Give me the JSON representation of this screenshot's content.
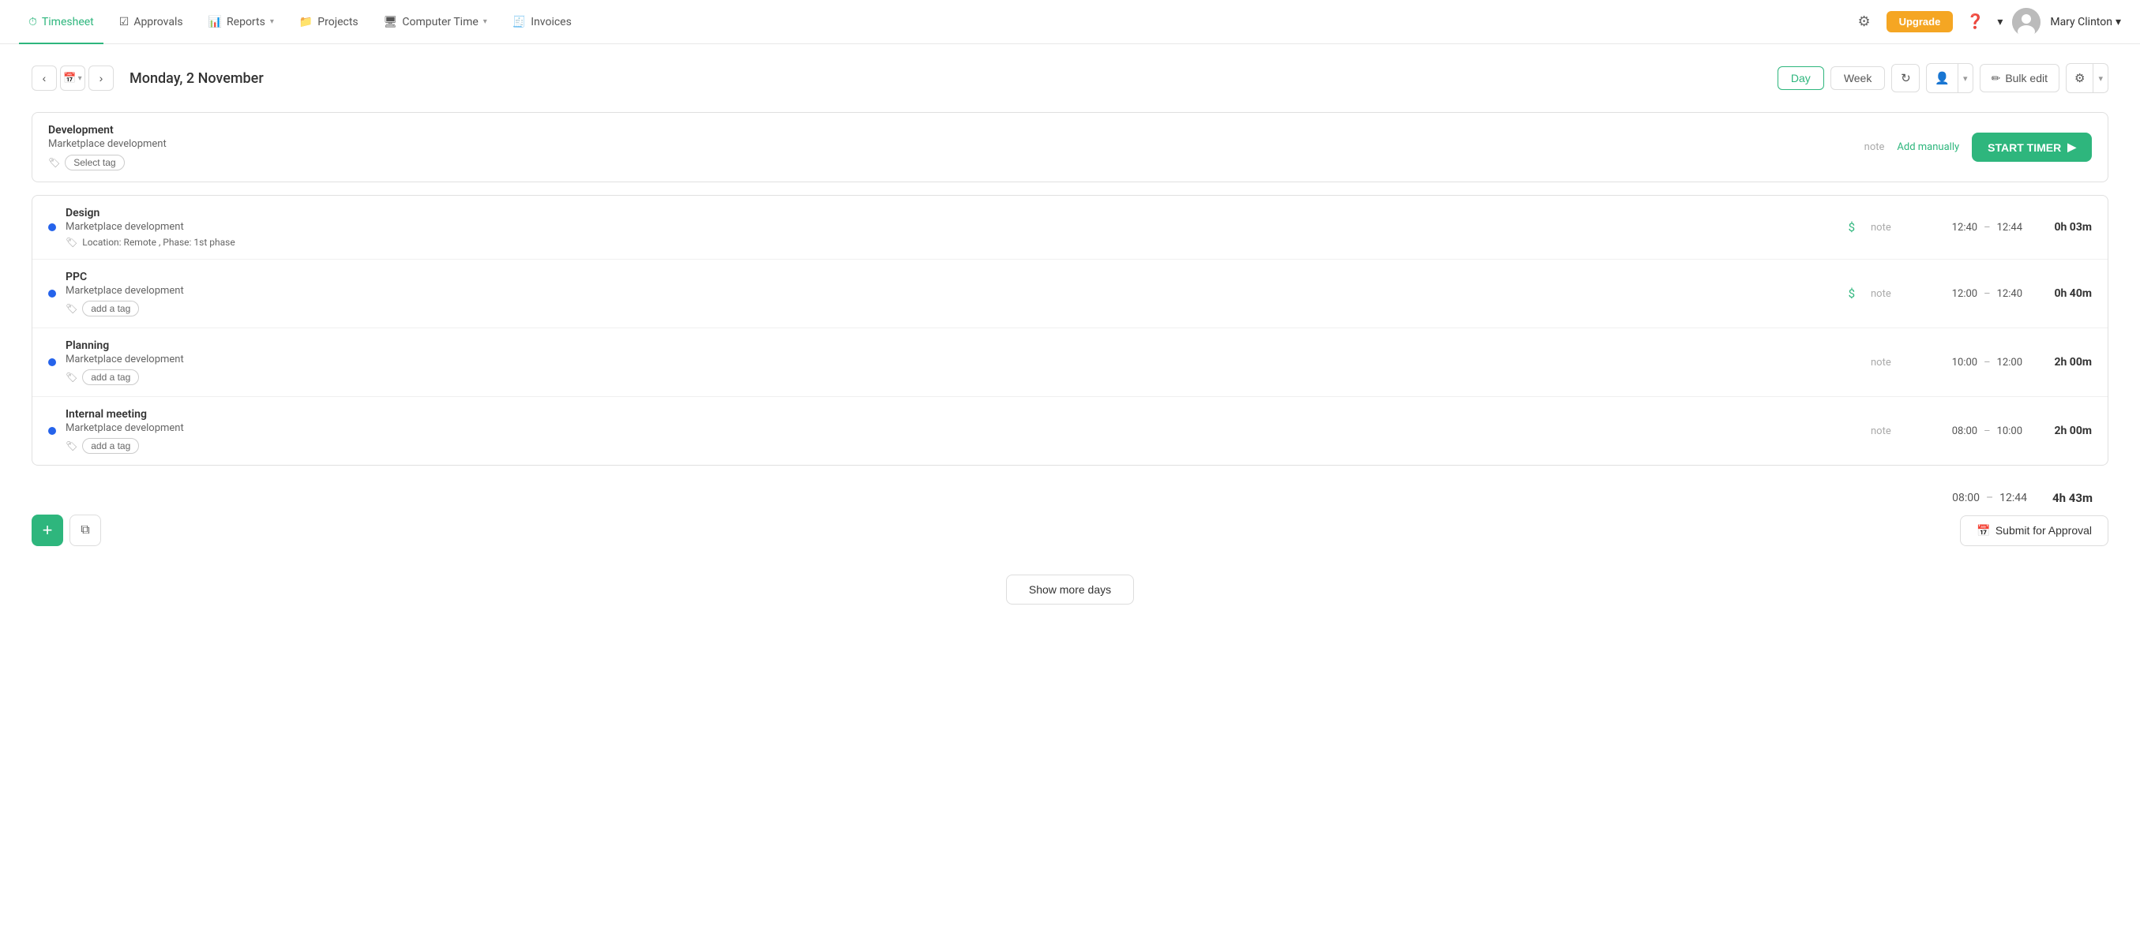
{
  "nav": {
    "items": [
      {
        "label": "Timesheet",
        "id": "timesheet",
        "active": true
      },
      {
        "label": "Approvals",
        "id": "approvals",
        "active": false
      },
      {
        "label": "Reports",
        "id": "reports",
        "active": false,
        "hasChevron": true
      },
      {
        "label": "Projects",
        "id": "projects",
        "active": false
      },
      {
        "label": "Computer Time",
        "id": "computer-time",
        "active": false,
        "hasChevron": true
      },
      {
        "label": "Invoices",
        "id": "invoices",
        "active": false
      }
    ],
    "upgrade_label": "Upgrade",
    "user_name": "Mary Clinton"
  },
  "toolbar": {
    "date": "Monday, 2 November",
    "day_label": "Day",
    "week_label": "Week",
    "bulk_edit_label": "Bulk edit"
  },
  "development_entry": {
    "project": "Development",
    "sub_project": "Marketplace development",
    "select_tag": "Select tag",
    "note": "note",
    "add_manually": "Add manually",
    "start_timer": "START TIMER"
  },
  "time_entries": [
    {
      "title": "Design",
      "project": "Marketplace development",
      "tags": "Location: Remote , Phase: 1st phase",
      "billable": true,
      "note": "note",
      "start": "12:40",
      "end": "12:44",
      "duration": "0h 03m"
    },
    {
      "title": "PPC",
      "project": "Marketplace development",
      "tags": null,
      "add_tag": "add a tag",
      "billable": true,
      "note": "note",
      "start": "12:00",
      "end": "12:40",
      "duration": "0h 40m"
    },
    {
      "title": "Planning",
      "project": "Marketplace development",
      "tags": null,
      "add_tag": "add a tag",
      "billable": false,
      "note": "note",
      "start": "10:00",
      "end": "12:00",
      "duration": "2h 00m"
    },
    {
      "title": "Internal meeting",
      "project": "Marketplace development",
      "tags": null,
      "add_tag": "add a tag",
      "billable": false,
      "note": "note",
      "start": "08:00",
      "end": "10:00",
      "duration": "2h 00m"
    }
  ],
  "summary": {
    "start": "08:00",
    "end": "12:44",
    "duration": "4h 43m",
    "submit_label": "Submit for Approval",
    "show_more": "Show more days"
  },
  "actions": {
    "add_label": "+",
    "copy_label": "⧉"
  }
}
